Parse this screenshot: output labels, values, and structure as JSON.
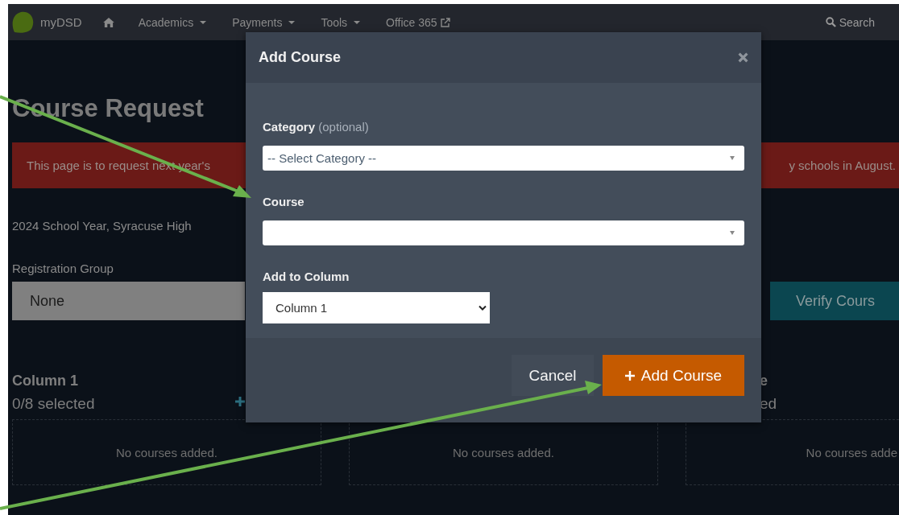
{
  "navbar": {
    "brand": "myDSD",
    "items": [
      {
        "label": "Academics",
        "dropdown": true,
        "external": false
      },
      {
        "label": "Payments",
        "dropdown": true,
        "external": false
      },
      {
        "label": "Tools",
        "dropdown": true,
        "external": false
      },
      {
        "label": "Office 365",
        "dropdown": false,
        "external": true
      }
    ],
    "search": "Search"
  },
  "page": {
    "title": "Course Request",
    "banner_left": "This page is to request next year's",
    "banner_right": "y schools in August.",
    "school_year": "2024 School Year, Syracuse High",
    "registration_group": {
      "label": "Registration Group",
      "value": "None"
    },
    "verify_button": "Verify Cours"
  },
  "columns": [
    {
      "title": "Column 1",
      "count": "0/8 selected",
      "empty": "No courses added.",
      "add_icon": true
    },
    {
      "empty": "No courses added."
    },
    {
      "title": "e",
      "count": "ed",
      "empty": "No courses adde",
      "add_icon": false
    }
  ],
  "modal": {
    "title": "Add Course",
    "category_label": "Category",
    "category_hint": "(optional)",
    "category_placeholder": "-- Select Category --",
    "course_label": "Course",
    "column_label": "Add to Column",
    "column_value": "Column 1",
    "cancel": "Cancel",
    "add": "Add Course"
  }
}
